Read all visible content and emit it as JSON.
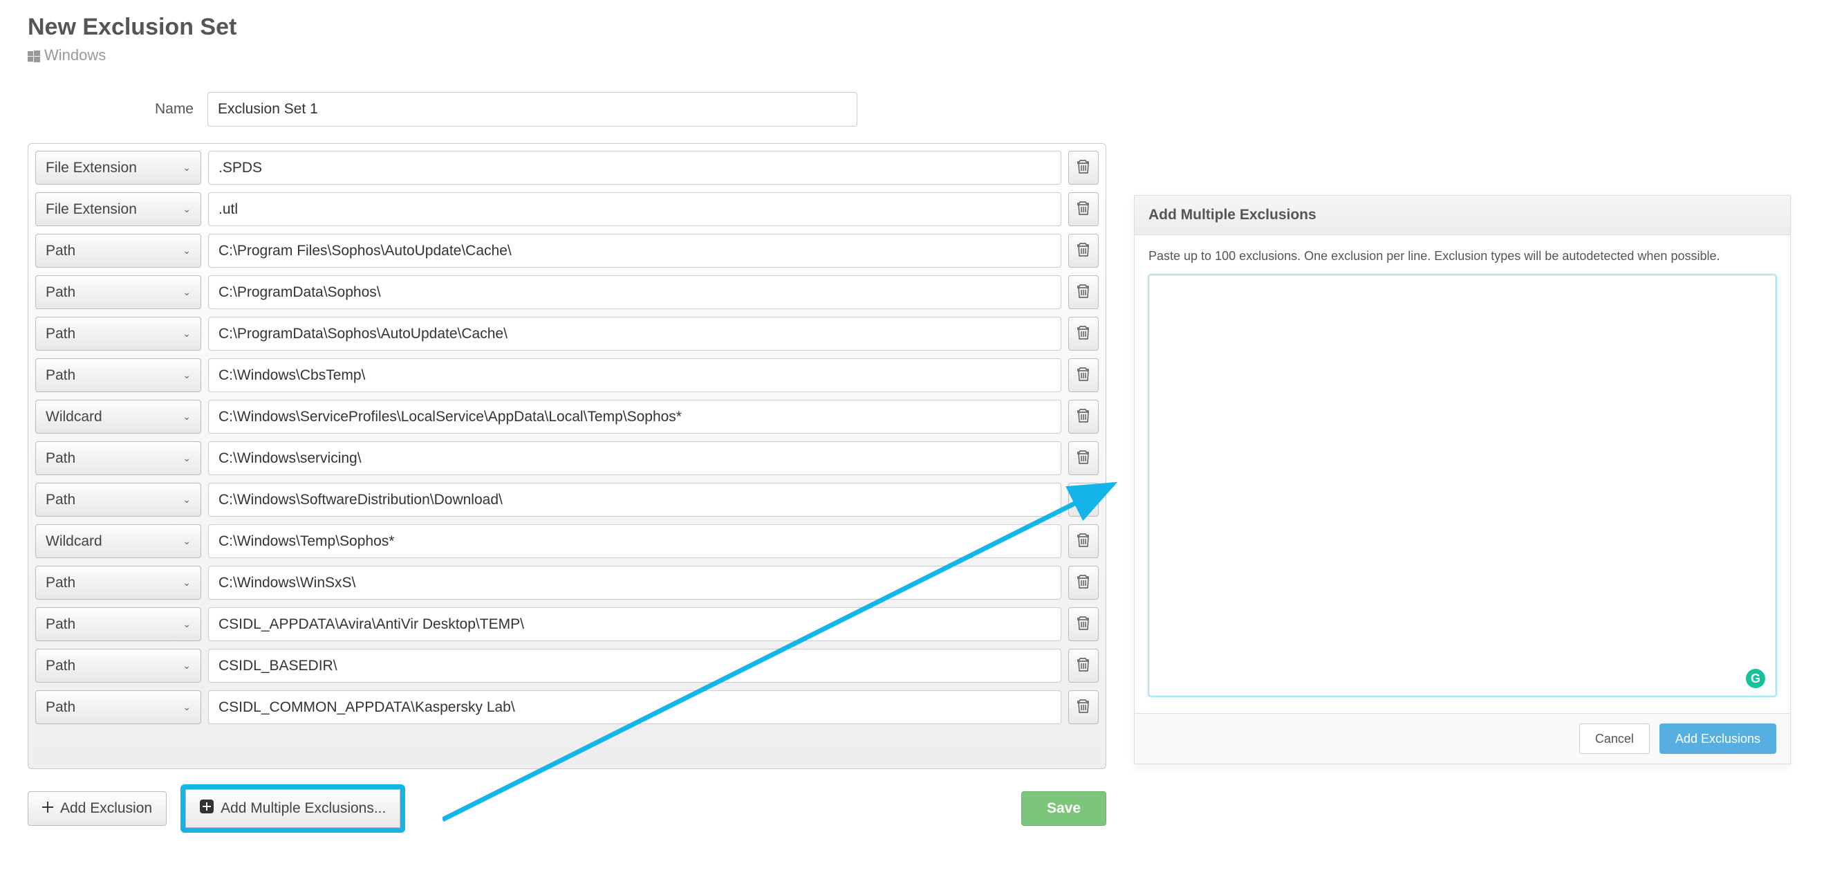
{
  "header": {
    "title": "New Exclusion Set",
    "os": "Windows",
    "name_label": "Name",
    "name_value": "Exclusion Set 1"
  },
  "rows": [
    {
      "type": "File Extension",
      "value": ".SPDS"
    },
    {
      "type": "File Extension",
      "value": ".utl"
    },
    {
      "type": "Path",
      "value": "C:\\Program Files\\Sophos\\AutoUpdate\\Cache\\"
    },
    {
      "type": "Path",
      "value": "C:\\ProgramData\\Sophos\\"
    },
    {
      "type": "Path",
      "value": "C:\\ProgramData\\Sophos\\AutoUpdate\\Cache\\"
    },
    {
      "type": "Path",
      "value": "C:\\Windows\\CbsTemp\\"
    },
    {
      "type": "Wildcard",
      "value": "C:\\Windows\\ServiceProfiles\\LocalService\\AppData\\Local\\Temp\\Sophos*"
    },
    {
      "type": "Path",
      "value": "C:\\Windows\\servicing\\"
    },
    {
      "type": "Path",
      "value": "C:\\Windows\\SoftwareDistribution\\Download\\"
    },
    {
      "type": "Wildcard",
      "value": "C:\\Windows\\Temp\\Sophos*"
    },
    {
      "type": "Path",
      "value": "C:\\Windows\\WinSxS\\"
    },
    {
      "type": "Path",
      "value": "CSIDL_APPDATA\\Avira\\AntiVir Desktop\\TEMP\\"
    },
    {
      "type": "Path",
      "value": "CSIDL_BASEDIR\\"
    },
    {
      "type": "Path",
      "value": "CSIDL_COMMON_APPDATA\\Kaspersky Lab\\"
    }
  ],
  "footer": {
    "add_exclusion": "Add Exclusion",
    "add_multiple": "Add Multiple Exclusions...",
    "save": "Save"
  },
  "dialog": {
    "title": "Add Multiple Exclusions",
    "hint": "Paste up to 100 exclusions. One exclusion per line. Exclusion types will be autodetected when possible.",
    "textarea_value": "",
    "cancel": "Cancel",
    "submit": "Add Exclusions",
    "badge": "G"
  }
}
